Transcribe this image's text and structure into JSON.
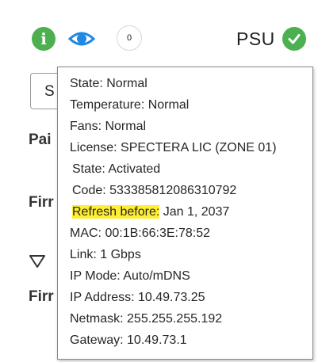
{
  "status_bar": {
    "icons": {
      "info": "info-icon",
      "visibility": "eye-icon",
      "psu_ok": "checkmark-icon"
    },
    "count": "0",
    "psu_label": "PSU"
  },
  "background": {
    "box_initial": "S",
    "row_labels": [
      "Pai",
      "Firr",
      "Firr"
    ]
  },
  "tooltip": {
    "lines": [
      "State: Normal",
      "Temperature: Normal",
      "Fans: Normal",
      "License: SPECTERA LIC (ZONE 01)",
      "State: Activated",
      "Code: 533385812086310792",
      "Refresh before:",
      "Jan 1, 2037",
      "MAC: 00:1B:66:3E:78:52",
      "Link: 1 Gbps",
      "IP Mode: Auto/mDNS",
      "IP Address: 10.49.73.25",
      "Netmask: 255.255.255.192",
      "Gateway: 10.49.73.1"
    ]
  },
  "colors": {
    "ok_green": "#4caf50",
    "accent_blue": "#1e88e5",
    "highlight_yellow": "#ffee33"
  }
}
